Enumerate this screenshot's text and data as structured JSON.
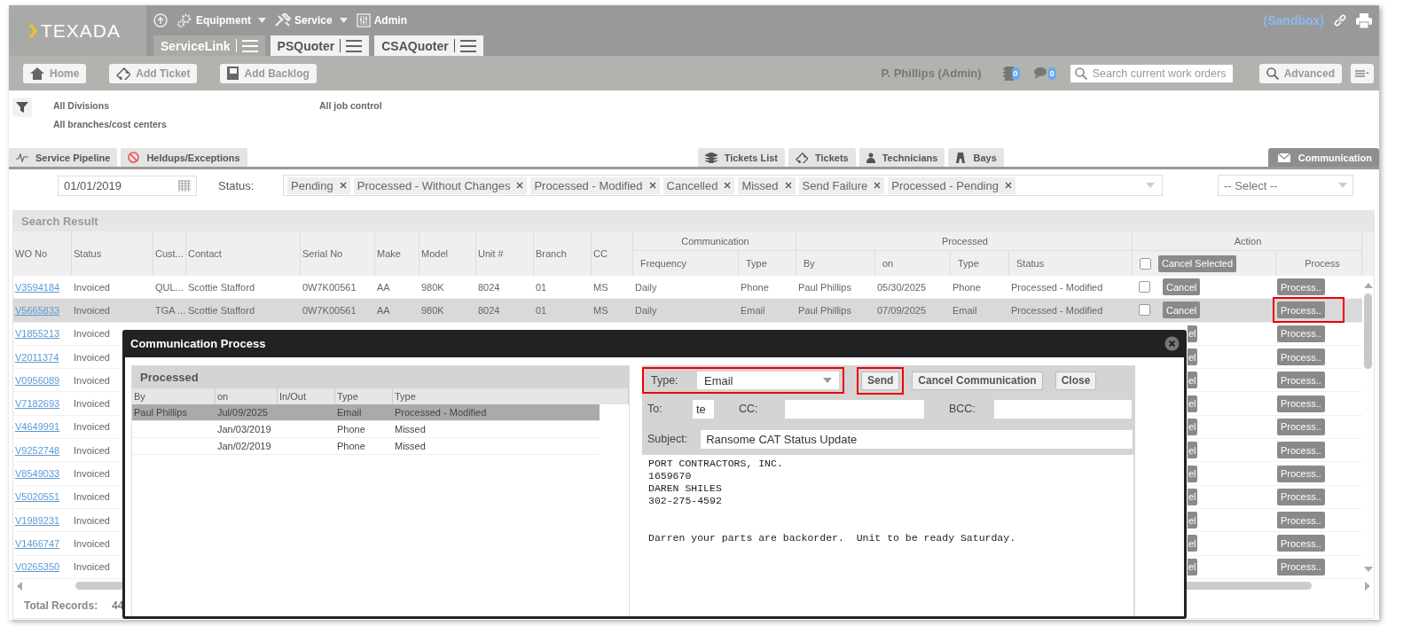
{
  "header": {
    "logo": "TEXADA",
    "menu": [
      {
        "label": "Equipment",
        "kind": "dropdown"
      },
      {
        "label": "Service",
        "kind": "dropdown"
      },
      {
        "label": "Admin",
        "kind": "plain"
      }
    ],
    "apps": [
      {
        "label": "ServiceLink",
        "selected": true
      },
      {
        "label": "PSQuoter",
        "selected": false
      },
      {
        "label": "CSAQuoter",
        "selected": false
      }
    ],
    "environment": "(Sandbox)"
  },
  "toolbar": {
    "buttons": [
      {
        "label": "Home",
        "kind": "home"
      },
      {
        "label": "Add Ticket",
        "kind": "ticket"
      },
      {
        "label": "Add Backlog",
        "kind": "backlog"
      }
    ],
    "user": "P. Phillips (Admin)",
    "counters": [
      "0",
      "0"
    ],
    "search": {
      "placeholder": "Search current work orders"
    },
    "advanced": "Advanced"
  },
  "filters": {
    "divisions": "All Divisions",
    "branches": "All branches/cost centers",
    "job_control": "All job control"
  },
  "tabs_left": [
    {
      "label": "Service Pipeline",
      "kind": "pulse",
      "selected": false
    },
    {
      "label": "Heldups/Exceptions",
      "kind": "blocked",
      "selected": false
    }
  ],
  "tabs_middle": [
    {
      "label": "Tickets List",
      "kind": "layers",
      "selected": false
    },
    {
      "label": "Tickets",
      "kind": "ticket",
      "selected": false
    },
    {
      "label": "Technicians",
      "kind": "person",
      "selected": false
    },
    {
      "label": "Bays",
      "kind": "bay",
      "selected": false
    }
  ],
  "tabs_right": [
    {
      "label": "Communication",
      "kind": "mail",
      "selected": true
    }
  ],
  "criteria": {
    "date": "01/01/2019",
    "status_label": "Status:",
    "statuses": [
      "Pending",
      "Processed - Without Changes",
      "Processed - Modified",
      "Cancelled",
      "Missed",
      "Send Failure",
      "Processed - Pending"
    ],
    "select_placeholder": "-- Select --"
  },
  "results": {
    "title": "Search Result",
    "columns": [
      "WO No",
      "Status",
      "Cust...",
      "Contact",
      "Serial No",
      "Make",
      "Model",
      "Unit #",
      "Branch",
      "CC"
    ],
    "communication": {
      "label": "Communication",
      "columns": [
        "Frequency",
        "Type"
      ]
    },
    "processed": {
      "label": "Processed",
      "columns": [
        "By",
        "on",
        "Type",
        "Status"
      ]
    },
    "action": {
      "label": "Action",
      "select_all": false,
      "cancel_selected": "Cancel Selected",
      "process": "Process"
    },
    "rows": [
      {
        "wo": "V3594184",
        "status": "Invoiced",
        "cells": [
          "QUL...",
          "Scottie Stafford",
          "0W7K00561",
          "AA",
          "980K",
          "8024",
          "01",
          "MS",
          "Daily",
          "Phone",
          "Paul Phillips",
          "05/30/2025",
          "Phone",
          "Processed - Modified"
        ],
        "checked": false,
        "cancel": "Cancel",
        "process": "Process..",
        "selected": false,
        "highlighted": false
      },
      {
        "wo": "V5665833",
        "status": "Invoiced",
        "cells": [
          "TGA ...",
          "Scottie Stafford",
          "0W7K00561",
          "AA",
          "980K",
          "8024",
          "01",
          "MS",
          "Daily",
          "Email",
          "Paul Phillips",
          "07/09/2025",
          "Email",
          "Processed - Modified"
        ],
        "checked": false,
        "cancel": "Cancel",
        "process": "Process..",
        "selected": true,
        "highlighted": true
      },
      {
        "wo": "V1855213",
        "status": "Invoiced",
        "cancel": "el",
        "process": "Process..",
        "selected": false,
        "highlighted": false
      },
      {
        "wo": "V2011374",
        "status": "Invoiced",
        "cancel": "el",
        "process": "Process..",
        "selected": false,
        "highlighted": false
      },
      {
        "wo": "V0956089",
        "status": "Invoiced",
        "cancel": "el",
        "process": "Process..",
        "selected": false,
        "highlighted": false
      },
      {
        "wo": "V7182693",
        "status": "Invoiced",
        "cancel": "el",
        "process": "Process..",
        "selected": false,
        "highlighted": false
      },
      {
        "wo": "V4649991",
        "status": "Invoiced",
        "cancel": "el",
        "process": "Process..",
        "selected": false,
        "highlighted": false
      },
      {
        "wo": "V9252748",
        "status": "Invoiced",
        "cancel": "el",
        "process": "Process..",
        "selected": false,
        "highlighted": false
      },
      {
        "wo": "V8549033",
        "status": "Invoiced",
        "cancel": "el",
        "process": "Process..",
        "selected": false,
        "highlighted": false
      },
      {
        "wo": "V5020551",
        "status": "Invoiced",
        "cancel": "el",
        "process": "Process..",
        "selected": false,
        "highlighted": false
      },
      {
        "wo": "V1989231",
        "status": "Invoiced",
        "cancel": "el",
        "process": "Process..",
        "selected": false,
        "highlighted": false
      },
      {
        "wo": "V1466747",
        "status": "Invoiced",
        "cancel": "el",
        "process": "Process..",
        "selected": false,
        "highlighted": false
      },
      {
        "wo": "V0265350",
        "status": "Invoiced",
        "cancel": "el",
        "process": "Process..",
        "selected": false,
        "highlighted": false
      }
    ],
    "total_label": "Total Records:",
    "total": "44"
  },
  "dialog": {
    "title": "Communication Process",
    "history": {
      "title": "Processed",
      "columns": [
        "By",
        "on",
        "In/Out",
        "Type",
        "Type"
      ],
      "rows": [
        {
          "by": "Paul Phillips",
          "on": "Jul/09/2025",
          "type": "Email",
          "status": "Processed - Modified",
          "selected": true
        },
        {
          "on": "Jan/03/2019",
          "type": "Phone",
          "status": "Missed",
          "selected": false
        },
        {
          "on": "Jan/02/2019",
          "type": "Phone",
          "status": "Missed",
          "selected": false
        }
      ]
    },
    "form": {
      "type_label": "Type:",
      "type_value": "Email",
      "type_highlighted": true,
      "buttons": [
        {
          "label": "Send",
          "highlighted": true
        },
        {
          "label": "Cancel Communication",
          "highlighted": false
        },
        {
          "label": "Close",
          "highlighted": false
        }
      ],
      "to_label": "To:",
      "to_value": "te",
      "cc_label": "CC:",
      "bcc_label": "BCC:",
      "subject_label": "Subject:",
      "subject_value": "Ransome CAT Status Update",
      "body_lines": [
        "PORT CONTRACTORS, INC.",
        "1659670",
        "DAREN SHILES",
        "302-275-4592"
      ],
      "message": "Darren your parts are backorder.  Unit to be ready Saturday."
    }
  }
}
